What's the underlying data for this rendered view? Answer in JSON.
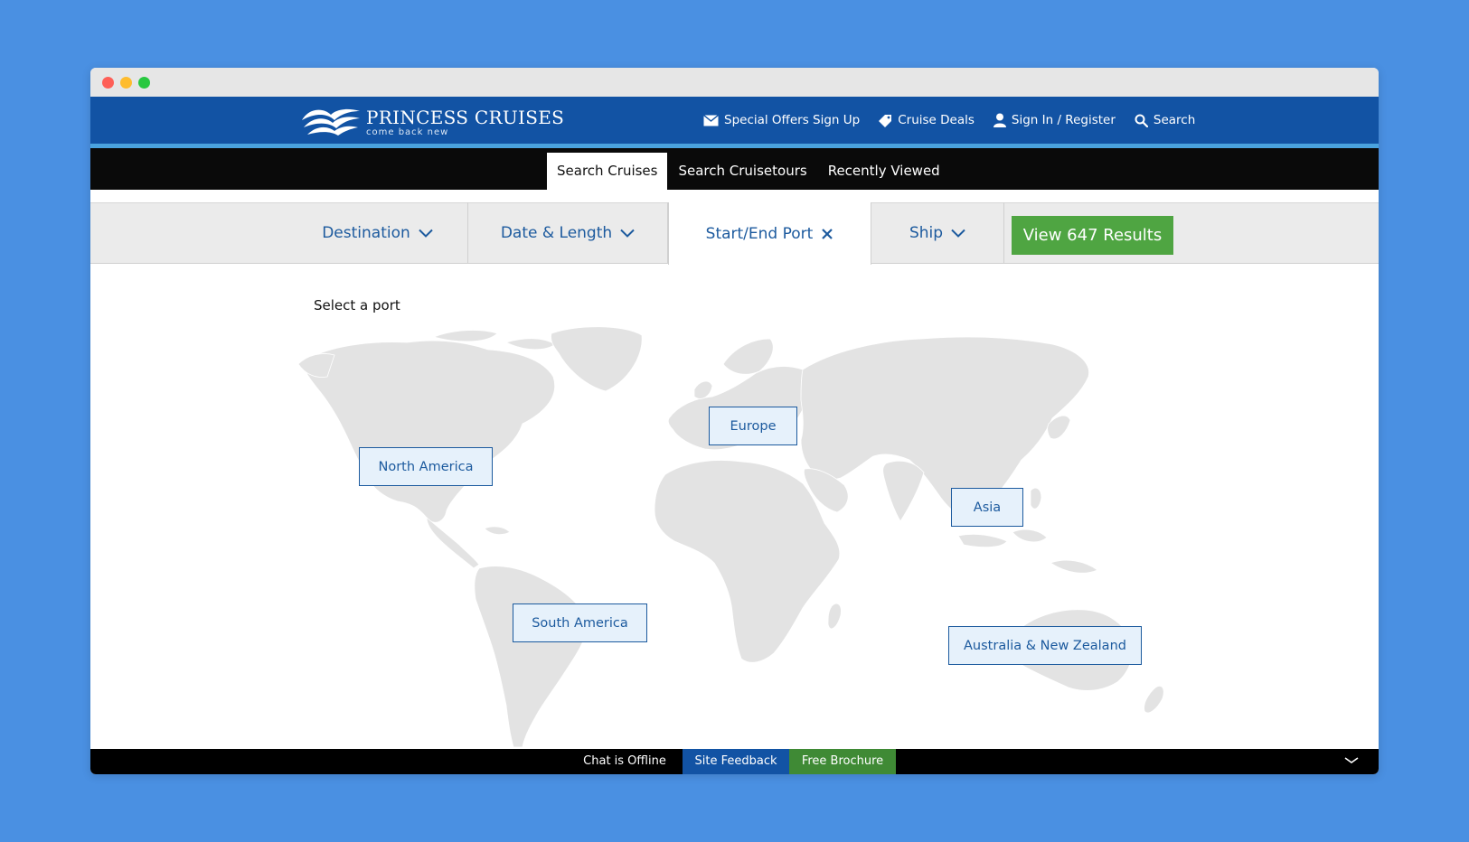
{
  "brand": {
    "name": "PRINCESS CRUISES",
    "tagline": "come back new"
  },
  "header_links": [
    {
      "label": "Special Offers Sign Up",
      "icon": "envelope-icon"
    },
    {
      "label": "Cruise Deals",
      "icon": "tag-icon"
    },
    {
      "label": "Sign In / Register",
      "icon": "user-icon"
    },
    {
      "label": "Search",
      "icon": "search-icon"
    }
  ],
  "subnav": {
    "tabs": [
      "Search Cruises",
      "Search Cruisetours",
      "Recently Viewed"
    ],
    "active": "Search Cruises"
  },
  "filters": {
    "destination": "Destination",
    "date_length": "Date & Length",
    "start_end_port": "Start/End Port",
    "ship": "Ship",
    "view_results": "View 647 Results"
  },
  "content": {
    "prompt": "Select a port",
    "regions": {
      "north_america": "North America",
      "europe": "Europe",
      "asia": "Asia",
      "south_america": "South America",
      "australia_nz": "Australia & New Zealand"
    }
  },
  "footer": {
    "chat": "Chat is Offline",
    "feedback": "Site Feedback",
    "brochure": "Free Brochure"
  },
  "colors": {
    "header_blue": "#1253a4",
    "link_blue": "#1c5a9e",
    "results_green": "#4fa542",
    "feedback_blue": "#1253a4",
    "brochure_green": "#3f8a35",
    "map_land": "#e3e3e3"
  }
}
